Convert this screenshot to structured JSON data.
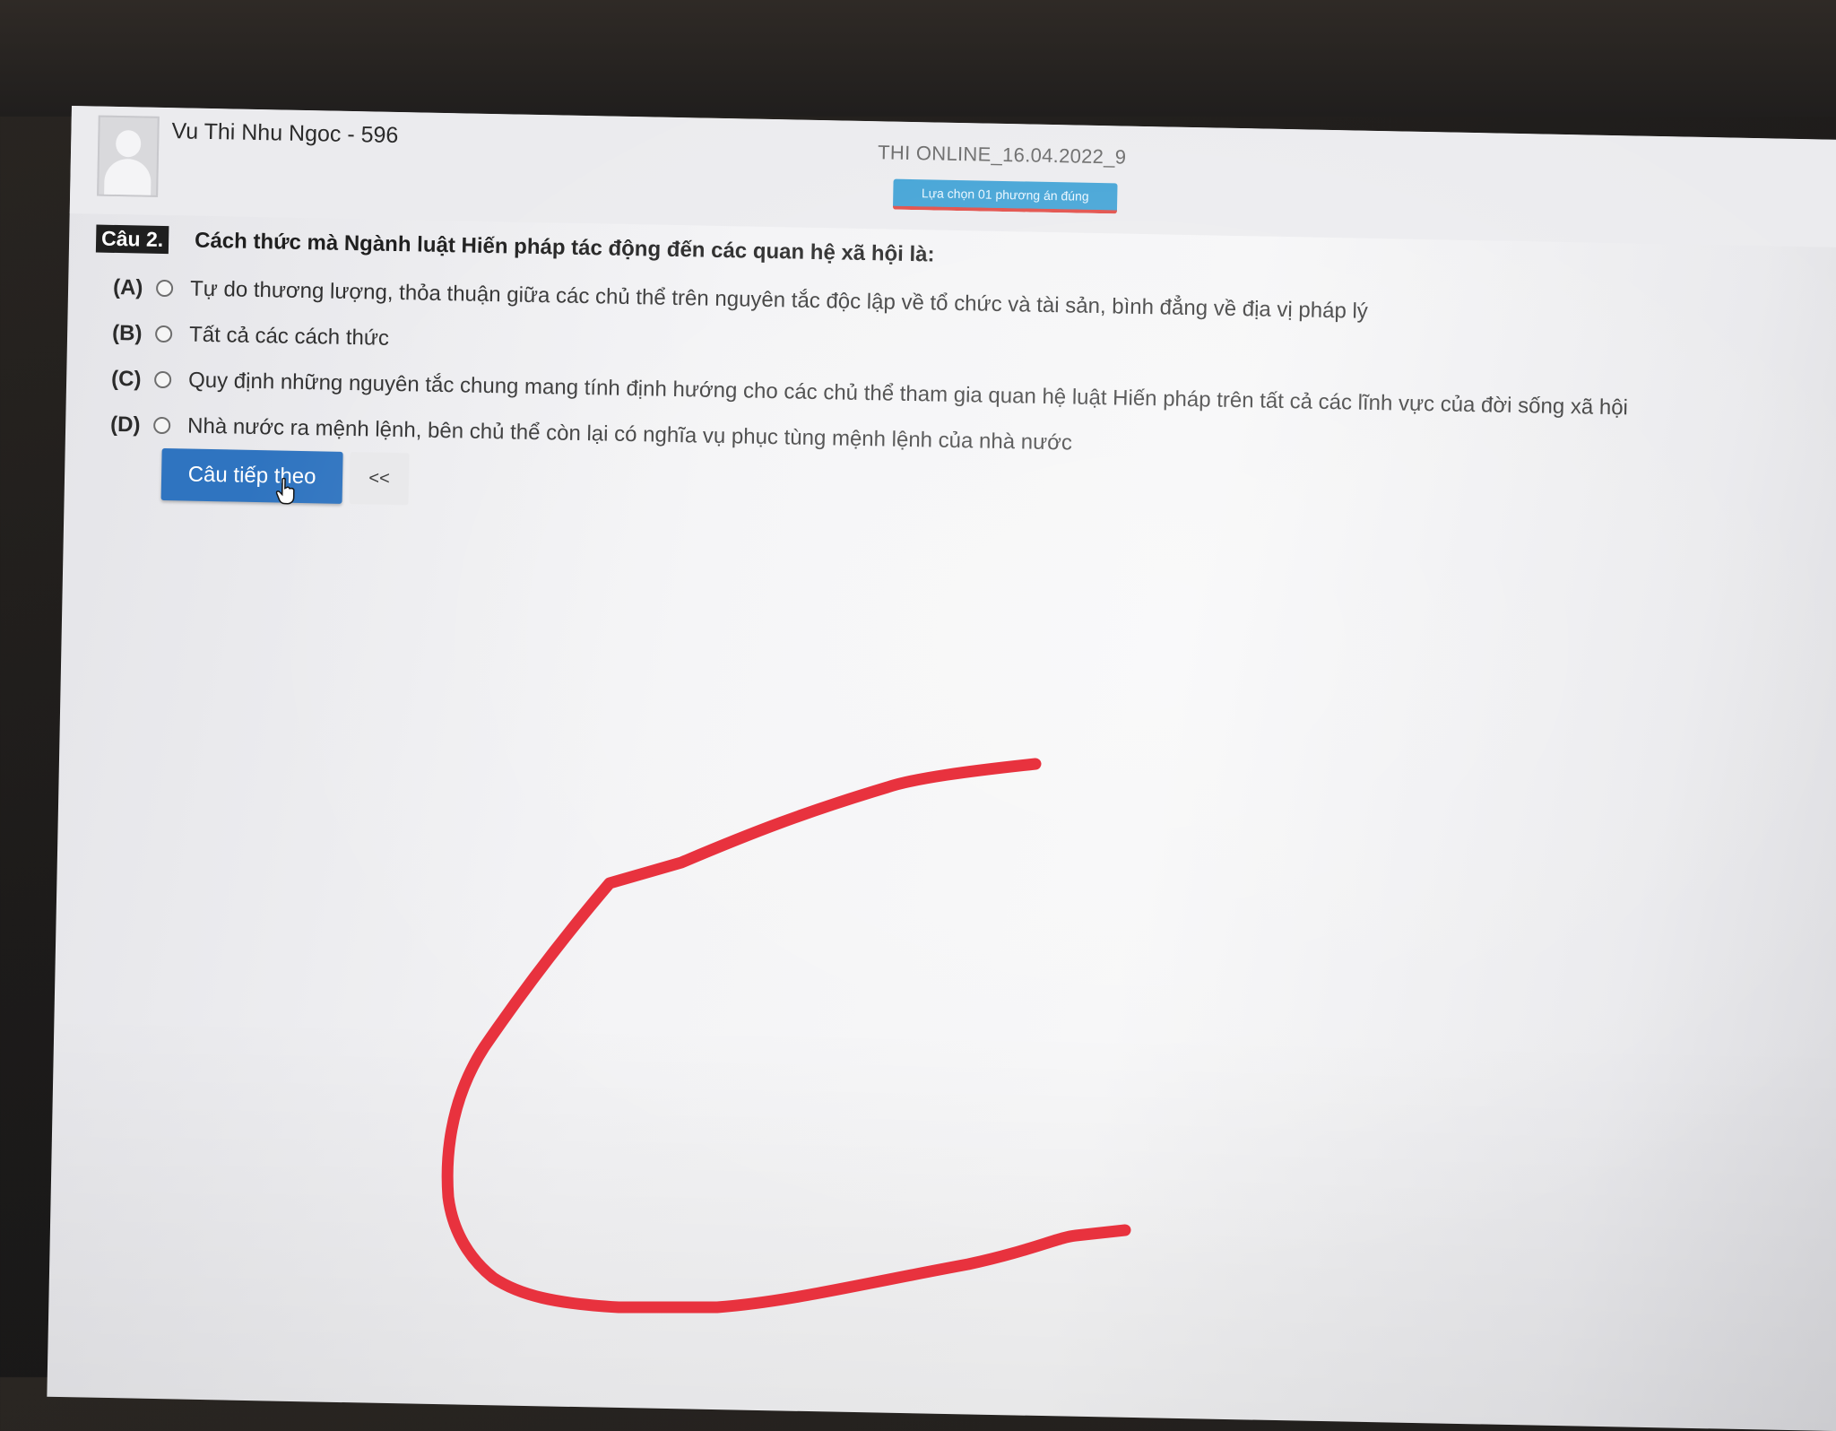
{
  "header": {
    "student_name": "Vu Thi Nhu Ngoc - 596",
    "exam_title": "THI ONLINE_16.04.2022_9",
    "instruction": "Lựa chọn 01 phương án đúng"
  },
  "question": {
    "number_label": "Câu 2.",
    "text": "Cách thức mà Ngành luật Hiến pháp tác động đến các quan hệ xã hội là:",
    "options": [
      {
        "letter": "(A)",
        "text": "Tự do thương lượng, thỏa thuận giữa các chủ thể trên nguyên tắc độc lập về tổ chức và tài sản, bình đẳng về địa vị pháp lý"
      },
      {
        "letter": "(B)",
        "text": "Tất cả các cách thức"
      },
      {
        "letter": "(C)",
        "text": "Quy định những nguyên tắc chung mang tính định hướng cho các chủ thể tham gia quan hệ luật Hiến pháp trên tất cả các lĩnh vực của đời sống xã hội"
      },
      {
        "letter": "(D)",
        "text": "Nhà nước ra mệnh lệnh, bên chủ thể còn lại có nghĩa vụ phục tùng mệnh lệnh của nhà nước"
      }
    ]
  },
  "navigation": {
    "next_label": "Câu tiếp theo",
    "prev_label": "<<"
  },
  "colors": {
    "primary_button": "#2f74c0",
    "badge": "#3a9fd4",
    "annotation_stroke": "#e8323e"
  }
}
